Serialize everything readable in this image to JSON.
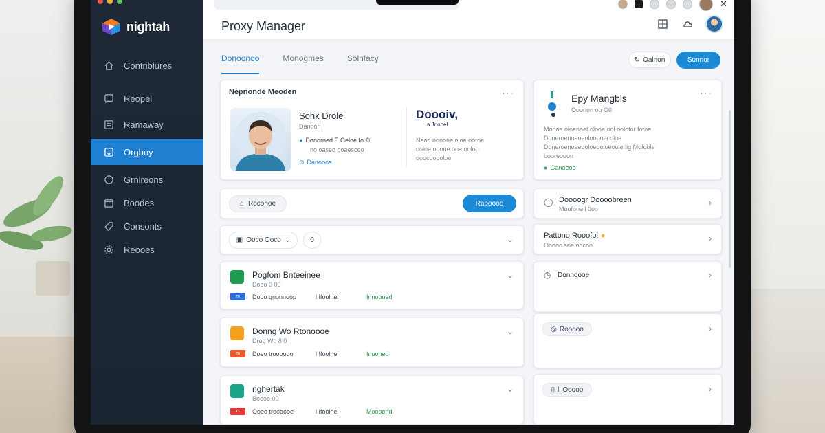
{
  "app": {
    "brand": "nightah",
    "title": "Proxy Manager"
  },
  "sidebar": {
    "items": [
      {
        "label": "Contriblures",
        "icon": "home-icon"
      },
      {
        "label": "Reopel",
        "icon": "chat-icon"
      },
      {
        "label": "Ramaway",
        "icon": "document-icon"
      },
      {
        "label": "Orgboy",
        "icon": "inbox-icon",
        "active": true
      },
      {
        "label": "Grnlreons",
        "icon": "globe-icon"
      },
      {
        "label": "Boodes",
        "icon": "calendar-icon"
      },
      {
        "label": "Consonts",
        "icon": "tag-icon"
      },
      {
        "label": "Reooes",
        "icon": "settings-icon"
      }
    ]
  },
  "tabs": [
    "Donoonoo",
    "Monogmes",
    "Solnfacy"
  ],
  "actions": {
    "ghost_label": "Oalnon",
    "primary_label": "Sonnor"
  },
  "profile_card": {
    "title": "Nepnonde Meoden",
    "name": "Sohk Drole",
    "sub": "Danoon",
    "detail1": "Donorned  E Oeloe to  ©",
    "detail2": "no oaseo ooaesceo",
    "link": "Danooos",
    "logo_text": "Doooiv,",
    "logo_sub": "a Jnooel",
    "desc1": "Neoo nonone oloe ooroe",
    "desc2": "ooloe ooone ooe ooloo",
    "desc3": "ooocooooloo"
  },
  "side_card": {
    "title": "Epy Mangbis",
    "sub": "Ooonon  oo  O0",
    "desc1": "Monoe oloenoet olooe ool oolotor fotoe",
    "desc2": "Doneroenoaoeolooooecoloe",
    "desc3": "Doneroenoaeooloeooloeoole  lig Mofoble",
    "desc4": "booreooon",
    "status": "Ganoeoo"
  },
  "search_row": {
    "chip_label": "Roconoe",
    "button_label": "Raooooo"
  },
  "filter_row": {
    "chip_label": "Ooco Ooco",
    "count": "0"
  },
  "list_items": [
    {
      "title": "Pogfom Bnteeinee",
      "sub": "Dooo 0 00",
      "meta": "Dooo gnonnoop",
      "count": "l Ifoolnel",
      "status": "Innooned",
      "color": "#1f9b4f",
      "tag_color": "#2d6fd6",
      "tag": "m"
    },
    {
      "title": "Donng Wo Rtonoooe",
      "sub": "Drog Wo 8 0",
      "meta": "Doeo troooooo",
      "count": "l  Ifoolnel",
      "status": "Inooned",
      "color": "#f4a11b",
      "tag_color": "#ef5a2c",
      "tag": "m"
    },
    {
      "title": "nghertak",
      "sub": "Boooo 00",
      "meta": "Ooeo troooooe",
      "count": "l  Ifoolnel",
      "status": "Moooond",
      "color": "#1aa58a",
      "tag_color": "#e23b3b",
      "tag": "o"
    }
  ],
  "right_items": [
    {
      "title": "Doooogr Doooobreen",
      "sub": "Moofone  l 0oo",
      "icon": "bell-icon"
    },
    {
      "title": "Pattono Rooofol",
      "sub": "Ooooo soe oocoo",
      "icon": "star-icon"
    },
    {
      "title": "Donnoooe",
      "sub": "",
      "icon": "clock-icon"
    },
    {
      "title": "Rooooo",
      "sub": "",
      "icon": "circle-icon"
    },
    {
      "title": "ll Ooooo",
      "sub": "",
      "icon": "doc-icon"
    }
  ],
  "colors": {
    "accent": "#1f7fd0",
    "sidebar": "#1e2836",
    "success": "#2c9a4d"
  }
}
